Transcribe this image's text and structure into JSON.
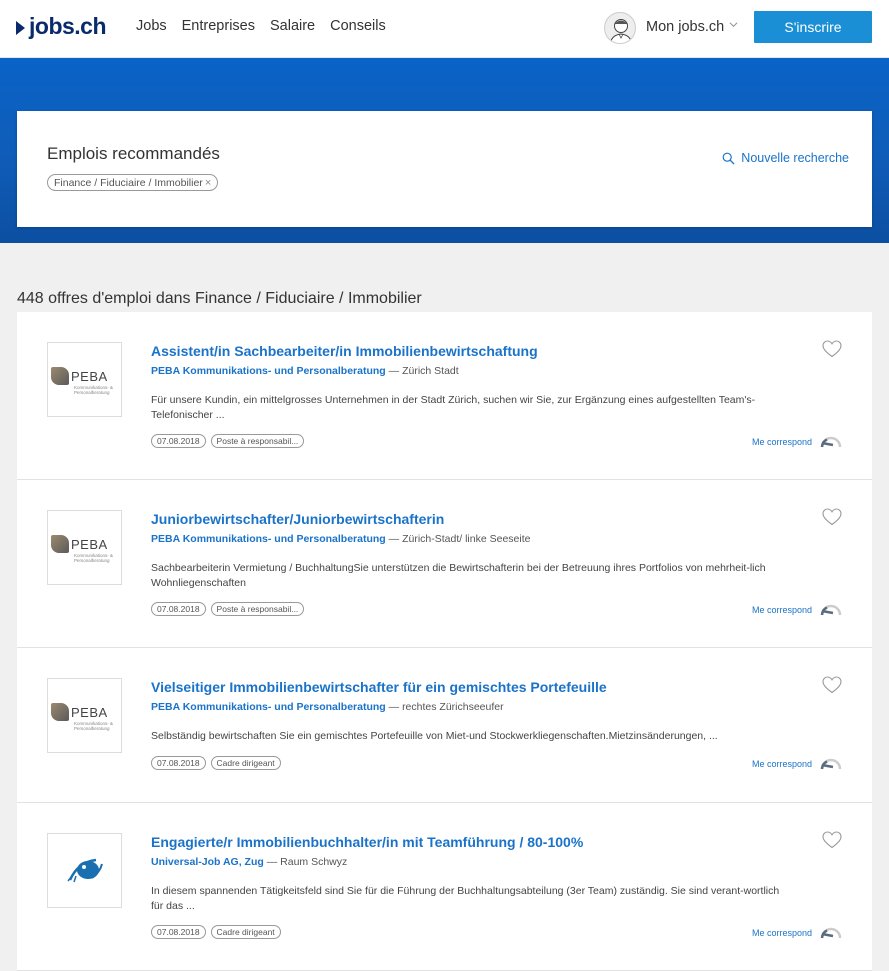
{
  "header": {
    "logo_text": "jobs.ch",
    "nav": [
      "Jobs",
      "Entreprises",
      "Salaire",
      "Conseils"
    ],
    "account_label": "Mon jobs.ch",
    "signup_label": "S'inscrire"
  },
  "search": {
    "title": "Emplois recommandés",
    "filter_chip": "Finance / Fiduciaire / Immobilier",
    "new_search_label": "Nouvelle recherche"
  },
  "results": {
    "count_text": "448 offres d'emploi dans Finance / Fiduciaire / Immobilier",
    "match_label": "Me correspond",
    "jobs": [
      {
        "logo": "PEBA",
        "logo_sub": "Kommunikations- & Personalberatung",
        "title": "Assistent/in Sachbearbeiter/in Immobilienbewirtschaftung",
        "company": "PEBA Kommunikations- und Personalberatung",
        "location": "Zürich Stadt",
        "description": "Für unsere Kundin, ein mittelgrosses Unternehmen in der Stadt Zürich, suchen wir Sie, zur Ergänzung eines aufgestellten Team's-Telefonischer ...",
        "date": "07.08.2018",
        "level": "Poste à responsabil..."
      },
      {
        "logo": "PEBA",
        "logo_sub": "Kommunikations- & Personalberatung",
        "title": "Juniorbewirtschafter/Juniorbewirtschafterin",
        "company": "PEBA Kommunikations- und Personalberatung",
        "location": "Zürich-Stadt/ linke Seeseite",
        "description": "Sachbearbeiterin Vermietung / BuchhaltungSie unterstützen die Bewirtschafterin bei der Betreuung ihres Portfolios von mehrheit-lich Wohnliegenschaften",
        "date": "07.08.2018",
        "level": "Poste à responsabil..."
      },
      {
        "logo": "PEBA",
        "logo_sub": "Kommunikations- & Personalberatung",
        "title": "Vielseitiger Immobilienbewirtschafter für ein gemischtes Portefeuille",
        "company": "PEBA Kommunikations- und Personalberatung",
        "location": "rechtes Zürichseeufer",
        "description": "Selbständig bewirtschaften Sie ein gemischtes Portefeuille  von Miet-und Stockwerkliegenschaften.Mietzinsänderungen, ...",
        "date": "07.08.2018",
        "level": "Cadre dirigeant"
      },
      {
        "logo": "",
        "logo_sub": "",
        "title": "Engagierte/r Immobilienbuchhalter/in mit Teamführung / 80-100%",
        "company": "Universal-Job AG, Zug",
        "location": "Raum Schwyz",
        "description": " In diesem spannenden Tätigkeitsfeld sind Sie für die Führung der Buchhaltungsabteilung (3er Team) zuständig. Sie sind verant-wortlich für das ...",
        "date": "07.08.2018",
        "level": "Cadre dirigeant"
      }
    ]
  }
}
